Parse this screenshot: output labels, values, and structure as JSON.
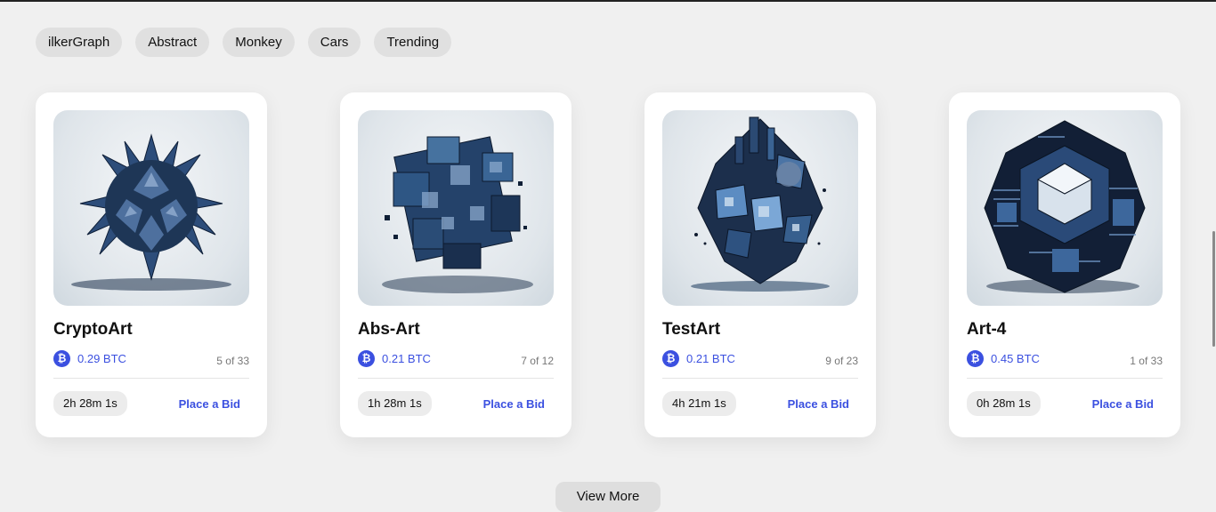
{
  "tags": [
    "ilkerGraph",
    "Abstract",
    "Monkey",
    "Cars",
    "Trending"
  ],
  "cards": [
    {
      "title": "CryptoArt",
      "price": "0.29 BTC",
      "edition": "5 of 33",
      "timer": "2h 28m 1s",
      "bid_label": "Place a Bid"
    },
    {
      "title": "Abs-Art",
      "price": "0.21 BTC",
      "edition": "7 of 12",
      "timer": "1h 28m 1s",
      "bid_label": "Place a Bid"
    },
    {
      "title": "TestArt",
      "price": "0.21 BTC",
      "edition": "9 of 23",
      "timer": "4h 21m 1s",
      "bid_label": "Place a Bid"
    },
    {
      "title": "Art-4",
      "price": "0.45 BTC",
      "edition": "1 of 33",
      "timer": "0h 28m 1s",
      "bid_label": "Place a Bid"
    }
  ],
  "btc_symbol": "₿",
  "view_more_label": "View More",
  "colors": {
    "accent": "#3b50e0",
    "background": "#f0f0f0",
    "card": "#ffffff"
  }
}
